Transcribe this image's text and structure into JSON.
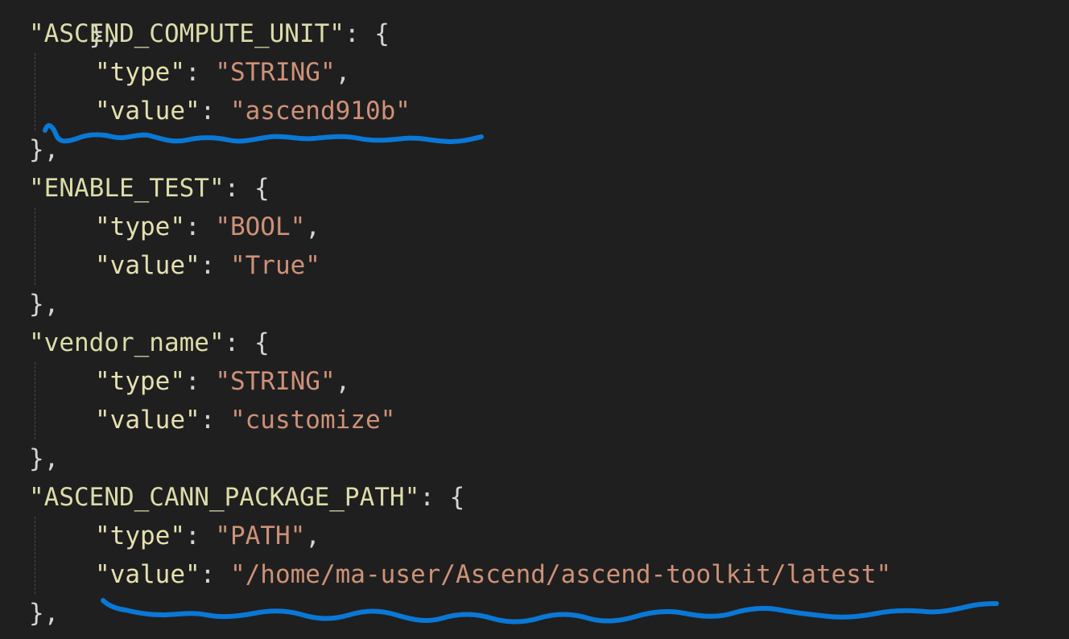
{
  "code": {
    "top_partial": "},",
    "blocks": [
      {
        "key": "\"ASCEND_COMPUTE_UNIT\"",
        "open": ": {",
        "type_key": "\"type\"",
        "type_value": "\"STRING\"",
        "value_key": "\"value\"",
        "value_value": "\"ascend910b\"",
        "close": "},"
      },
      {
        "key": "\"ENABLE_TEST\"",
        "open": ": {",
        "type_key": "\"type\"",
        "type_value": "\"BOOL\"",
        "value_key": "\"value\"",
        "value_value": "\"True\"",
        "close": "},"
      },
      {
        "key": "\"vendor_name\"",
        "open": ": {",
        "type_key": "\"type\"",
        "type_value": "\"STRING\"",
        "value_key": "\"value\"",
        "value_value": "\"customize\"",
        "close": "},"
      },
      {
        "key": "\"ASCEND_CANN_PACKAGE_PATH\"",
        "open": ": {",
        "type_key": "\"type\"",
        "type_value": "\"PATH\"",
        "value_key": "\"value\"",
        "value_value": "\"/home/ma-user/Ascend/ascend-toolkit/latest\"",
        "close": "},"
      }
    ]
  },
  "colors": {
    "background": "#1f1f1f",
    "json_key": "#dcdcaa",
    "string_value": "#ce9178",
    "punctuation": "#d4d4d4",
    "annotation": "#0a78d6"
  }
}
